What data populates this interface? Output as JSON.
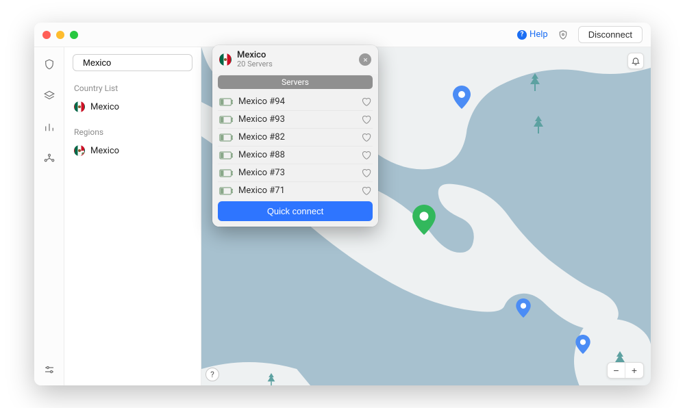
{
  "titlebar": {
    "help_label": "Help",
    "disconnect_label": "Disconnect"
  },
  "sidebar": {
    "search_value": "Mexico",
    "country_list_label": "Country List",
    "regions_label": "Regions",
    "country_item": "Mexico",
    "region_item": "Mexico"
  },
  "popover": {
    "title": "Mexico",
    "subtitle": "20 Servers",
    "tab_label": "Servers",
    "servers": [
      "Mexico #94",
      "Mexico #93",
      "Mexico #82",
      "Mexico #88",
      "Mexico #73",
      "Mexico #71"
    ],
    "quick_connect_label": "Quick connect"
  },
  "map": {
    "help_char": "?",
    "zoom_out": "−",
    "zoom_in": "+"
  }
}
